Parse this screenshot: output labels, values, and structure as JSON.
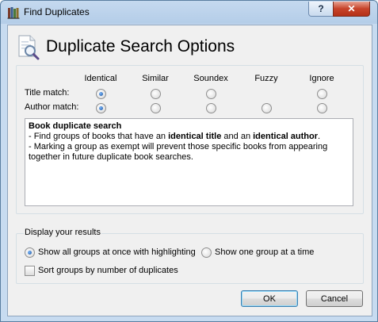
{
  "window": {
    "title": "Find Duplicates",
    "help_label": "?",
    "close_label": "✕"
  },
  "header": {
    "title": "Duplicate Search Options"
  },
  "match": {
    "columns": [
      "Identical",
      "Similar",
      "Soundex",
      "Fuzzy",
      "Ignore"
    ],
    "rows": [
      {
        "label": "Title match:",
        "options": [
          true,
          true,
          true,
          false,
          true
        ],
        "selected": 0
      },
      {
        "label": "Author match:",
        "options": [
          true,
          true,
          true,
          true,
          true
        ],
        "selected": 0
      }
    ]
  },
  "description": {
    "heading": "Book duplicate search",
    "line1_a": "- Find groups of books that have an ",
    "line1_b": "identical title",
    "line1_c": " and an ",
    "line1_d": "identical author",
    "line1_e": ".",
    "line2": "- Marking a group as exempt will prevent those specific books from appearing together in future duplicate book searches."
  },
  "display": {
    "legend": "Display your results",
    "opt_all": "Show all groups at once with highlighting",
    "opt_one": "Show one group at a time",
    "selected": "all",
    "sort_label": "Sort groups by number of duplicates",
    "sort_checked": false
  },
  "buttons": {
    "ok": "OK",
    "cancel": "Cancel"
  }
}
